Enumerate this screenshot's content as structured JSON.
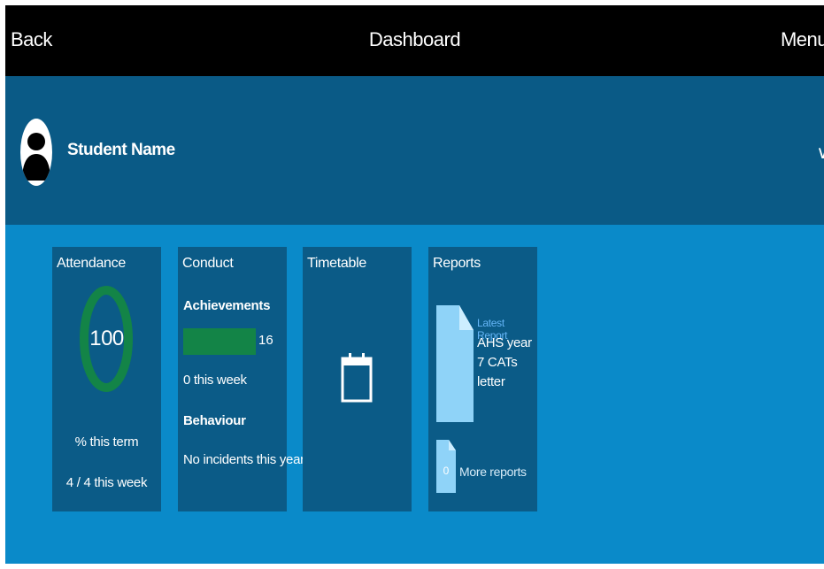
{
  "topbar": {
    "back_label": "Back",
    "title": "Dashboard",
    "menu_label": "Menu"
  },
  "student": {
    "name": "Student Name",
    "expand_icon": "chevron-down-icon",
    "avatar_icon": "person-silhouette-icon"
  },
  "colors": {
    "topbar": "#000000",
    "student_bar": "#0a5a86",
    "content_bg": "#0a8ac9",
    "tile_bg": "#0b5b87",
    "accent_green": "#138447",
    "document": "#8fd3f8",
    "link_blue": "#64b5f6"
  },
  "tiles": {
    "attendance": {
      "title": "Attendance",
      "value": "100",
      "term_label": "% this term",
      "week_label": "4 / 4 this week",
      "ring_fraction": 1.0
    },
    "conduct": {
      "title": "Conduct",
      "achievements_heading": "Achievements",
      "achievements_count": "16",
      "achievements_week": "0 this week",
      "behaviour_heading": "Behaviour",
      "behaviour_text": "No incidents this year"
    },
    "timetable": {
      "title": "Timetable",
      "icon": "calendar-icon"
    },
    "reports": {
      "title": "Reports",
      "latest_label": "Latest Report",
      "latest_name": "AHS year 7 CATs letter",
      "more_count": "0",
      "more_label": "More reports",
      "icon": "document-icon"
    }
  }
}
